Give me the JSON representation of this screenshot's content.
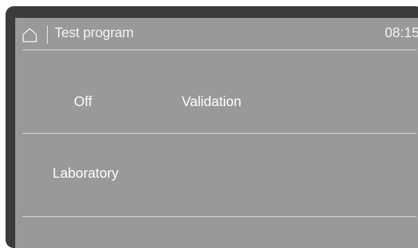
{
  "header": {
    "home_icon": "home-icon",
    "title": "Test program",
    "time": "08:15"
  },
  "options": {
    "off": "Off",
    "validation": "Validation",
    "laboratory": "Laboratory"
  },
  "colors": {
    "bezel": "#3b3b3b",
    "screen": "#999999",
    "text": "#ffffff"
  }
}
